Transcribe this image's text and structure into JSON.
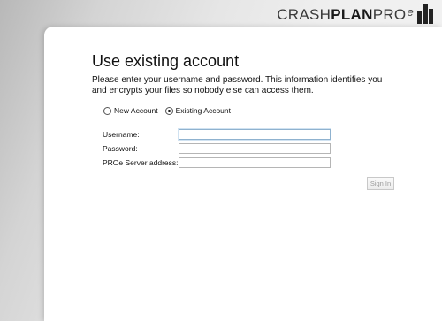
{
  "logo": {
    "part_light": "CRASH",
    "part_bold": "PLAN",
    "part_product": "PRO",
    "part_sup": "e"
  },
  "page": {
    "title": "Use existing account",
    "description": "Please enter your username and password. This information identifies you and encrypts your files so nobody else can access them."
  },
  "account_type": {
    "options": [
      {
        "label": "New Account",
        "selected": false
      },
      {
        "label": "Existing Account",
        "selected": true
      }
    ]
  },
  "form": {
    "username": {
      "label": "Username:",
      "value": ""
    },
    "password": {
      "label": "Password:",
      "value": ""
    },
    "server": {
      "label": "PROe Server address:",
      "value": ""
    }
  },
  "actions": {
    "sign_in_label": "Sign In"
  }
}
